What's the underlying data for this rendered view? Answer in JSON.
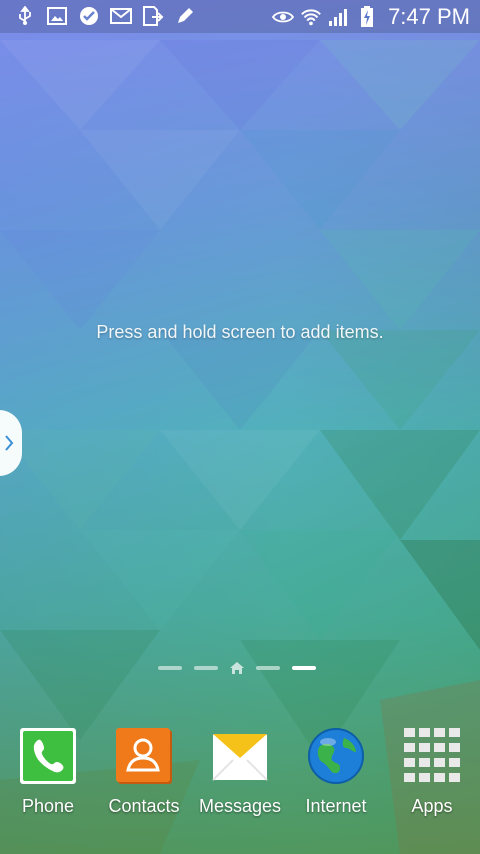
{
  "status_bar": {
    "time": "7:47 PM",
    "left_icons": [
      "usb-icon",
      "gallery-icon",
      "task-check-icon",
      "email-icon",
      "file-transfer-icon",
      "pencil-icon"
    ],
    "right_icons": [
      "eye-icon",
      "wifi-icon",
      "signal-icon",
      "battery-charging-icon"
    ]
  },
  "home": {
    "hint": "Press and hold screen to add items."
  },
  "page_indicator": {
    "pages": 5,
    "home_index": 2,
    "active_index": 4
  },
  "dock": {
    "items": [
      {
        "label": "Phone",
        "icon": "phone-icon"
      },
      {
        "label": "Contacts",
        "icon": "contacts-icon"
      },
      {
        "label": "Messages",
        "icon": "messages-icon"
      },
      {
        "label": "Internet",
        "icon": "globe-icon"
      },
      {
        "label": "Apps",
        "icon": "apps-grid-icon"
      }
    ]
  },
  "colors": {
    "phone": "#3fbf3f",
    "contacts": "#f07a1a",
    "messages": "#f5c21a",
    "internet": "#1e7fd8"
  }
}
